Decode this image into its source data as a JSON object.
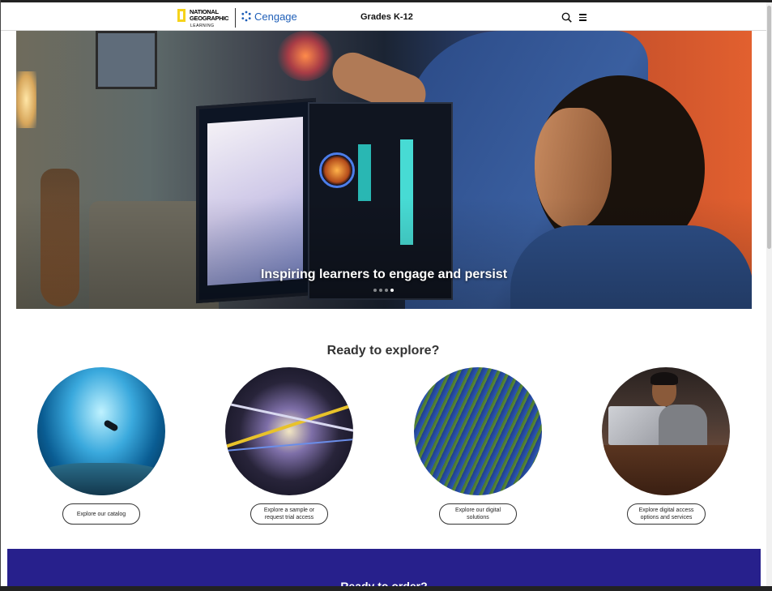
{
  "header": {
    "brand_ng": "NATIONAL\nGEOGRAPHIC",
    "brand_ng_sub": "LEARNING",
    "brand_cengage": "Cengage",
    "grades_link": "Grades K-12"
  },
  "hero": {
    "caption": "Inspiring learners to engage and persist",
    "slides_total": 4,
    "active_slide": 4
  },
  "explore": {
    "title": "Ready to explore?",
    "cards": [
      {
        "button": "Explore our catalog",
        "image": "scuba diver in underwater cave"
      },
      {
        "button": "Explore a sample or request trial access",
        "image": "abstract light streaks"
      },
      {
        "button": "Explore our digital solutions",
        "image": "aerial view of solar panels"
      },
      {
        "button": "Explore digital access options and services",
        "image": "student with laptop"
      }
    ]
  },
  "order": {
    "title": "Ready to order?",
    "color": "#27208c"
  },
  "colors": {
    "ng_yellow": "#f6d31b",
    "cengage_blue": "#1f5fb8"
  }
}
